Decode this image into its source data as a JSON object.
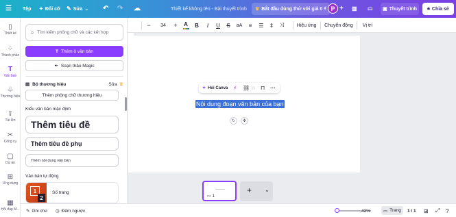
{
  "topbar": {
    "menu_icon": "hamburger-icon",
    "file_label": "Tệp",
    "resize_label": "Đổi cỡ",
    "edit_label": "Sửa",
    "doc_title": "Thiết kế không tên - Bài thuyết trình",
    "trial_label": "Bắt đầu dùng thử với giá 0 ₫",
    "avatar_letter": "P",
    "present_label": "Thuyết trình",
    "share_label": "Chia sẻ"
  },
  "rail": {
    "items": [
      {
        "label": "Thiết kế",
        "icon": "layout-icon"
      },
      {
        "label": "Thành phần",
        "icon": "elements-icon"
      },
      {
        "label": "Văn bản",
        "icon": "text-icon"
      },
      {
        "label": "Thương hiệu",
        "icon": "brand-icon"
      },
      {
        "label": "Tải lên",
        "icon": "upload-icon"
      },
      {
        "label": "Công cụ",
        "icon": "tools-icon"
      },
      {
        "label": "Dự án",
        "icon": "folder-icon"
      },
      {
        "label": "Ứng dụng",
        "icon": "apps-icon"
      },
      {
        "label": "Hỏi đáp M...",
        "icon": "help-icon"
      }
    ]
  },
  "panel": {
    "search_placeholder": "Tìm kiếm phông chữ và các kết hợp",
    "add_textbox": "Thêm ô văn bản",
    "magic_write": "Soạn thảo Magic",
    "brand_kit": "Bộ thương hiệu",
    "brand_edit": "Sửa",
    "add_brand_fonts": "Thêm phông chữ thương hiệu",
    "default_styles": "Kiểu văn bản mặc định",
    "heading": "Thêm tiêu đề",
    "subheading": "Thêm tiêu đề phụ",
    "body": "Thêm nội dung văn bản",
    "dynamic_text": "Văn bản tự động",
    "page_numbers": "Số trang",
    "thumb_digit_1": "1",
    "thumb_digit_2": "2"
  },
  "toolbar": {
    "font_size": "34",
    "effects": "Hiệu ứng",
    "animate": "Chuyển động",
    "position": "Vị trí"
  },
  "canvas": {
    "selected_text": "Nội dung đoạn văn bản của bạn",
    "ask_canva": "Hỏi Canva"
  },
  "thumbs": {
    "page_number": "1"
  },
  "bottombar": {
    "notes": "Ghi chú",
    "timer": "Đếm ngược",
    "zoom": "42%",
    "zoom_fraction": 0.42,
    "pages": "Trang",
    "page_count": "1 / 1"
  },
  "colors": {
    "accent": "#8b3dff",
    "selection": "#3a6fd8"
  }
}
